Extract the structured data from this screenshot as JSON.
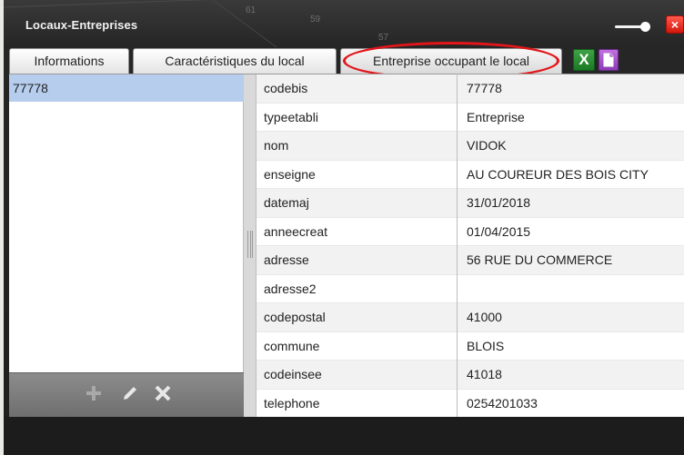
{
  "window": {
    "title": "Locaux-Entreprises",
    "close_label": "×"
  },
  "map_labels": [
    "61",
    "59",
    "57"
  ],
  "tabs": [
    {
      "label": "Informations"
    },
    {
      "label": "Caractéristiques du local"
    },
    {
      "label": "Entreprise occupant le local"
    }
  ],
  "export": {
    "excel_label": "X"
  },
  "list": {
    "items": [
      "77778"
    ]
  },
  "properties": [
    {
      "key": "codebis",
      "value": "77778"
    },
    {
      "key": "typeetabli",
      "value": "Entreprise"
    },
    {
      "key": "nom",
      "value": "VIDOK"
    },
    {
      "key": "enseigne",
      "value": "AU COUREUR DES BOIS CITY"
    },
    {
      "key": "datemaj",
      "value": "31/01/2018"
    },
    {
      "key": "anneecreat",
      "value": "01/04/2015"
    },
    {
      "key": "adresse",
      "value": "56 RUE DU COMMERCE"
    },
    {
      "key": "adresse2",
      "value": ""
    },
    {
      "key": "codepostal",
      "value": "41000"
    },
    {
      "key": "commune",
      "value": "BLOIS"
    },
    {
      "key": "codeinsee",
      "value": "41018"
    },
    {
      "key": "telephone",
      "value": "0254201033"
    }
  ],
  "colors": {
    "highlight_ellipse": "#e3151a",
    "selected_row": "#b6cdee",
    "excel": "#1b7a24",
    "document": "#8d3cb6",
    "close": "#d4160b"
  }
}
